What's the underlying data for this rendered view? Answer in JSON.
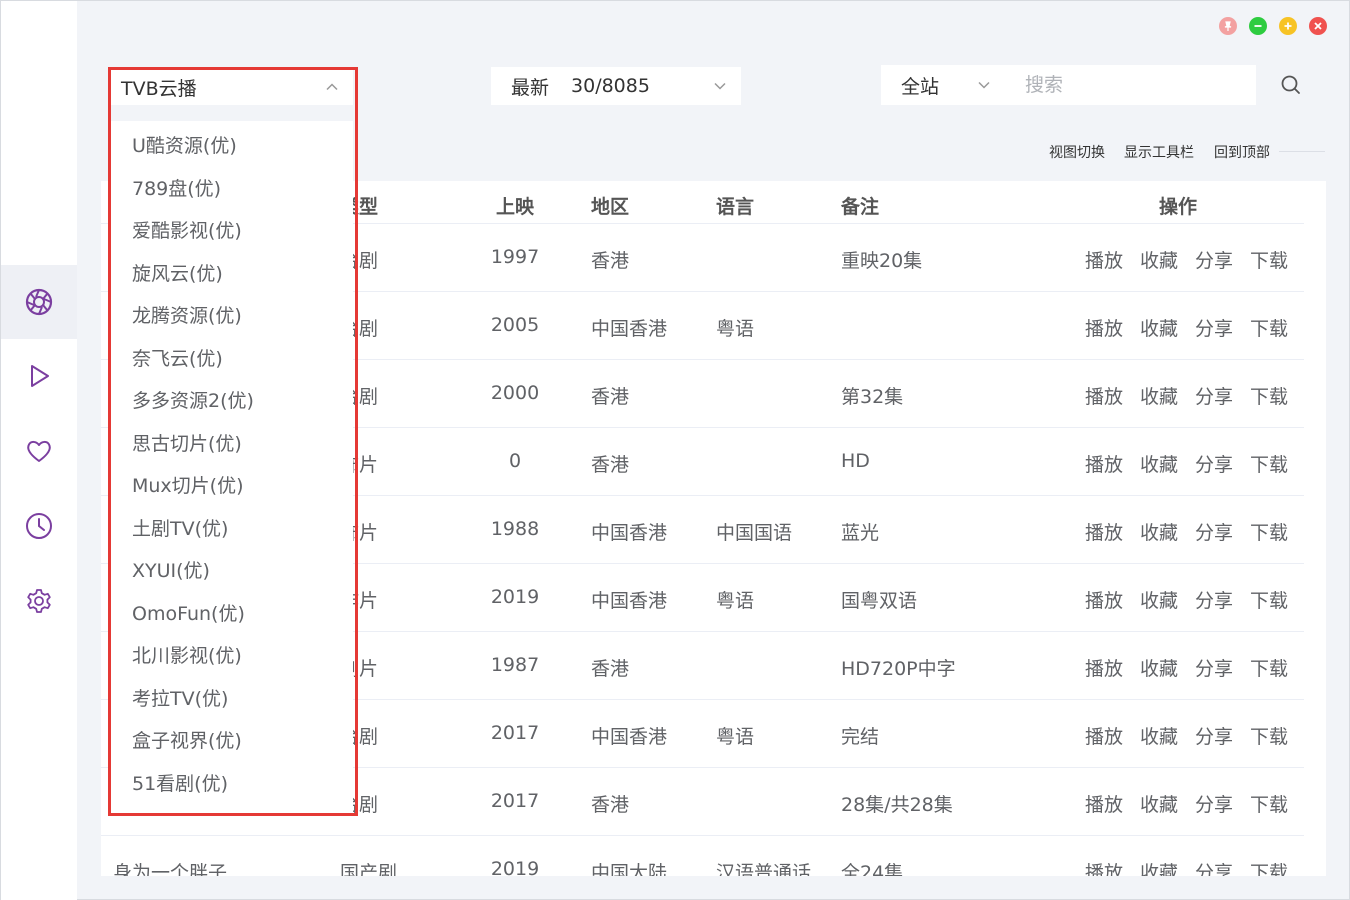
{
  "source": {
    "selected": "TVB云播"
  },
  "sort": {
    "label": "最新",
    "count": "30/8085"
  },
  "scope": {
    "label": "全站"
  },
  "search": {
    "placeholder": "搜索"
  },
  "toolbar": {
    "view_switch": "视图切换",
    "show_toolbar": "显示工具栏",
    "back_to_top": "回到顶部"
  },
  "table": {
    "headers": {
      "name": "",
      "type": "类型",
      "year": "上映",
      "region": "地区",
      "language": "语言",
      "note": "备注",
      "actions": "操作"
    },
    "actions": {
      "play": "播放",
      "favorite": "收藏",
      "share": "分享",
      "download": "下载"
    },
    "rows": [
      {
        "name": "",
        "type": "台剧",
        "year": "1997",
        "region": "香港",
        "language": "",
        "note": "重映20集"
      },
      {
        "name": "",
        "type": "台剧",
        "year": "2005",
        "region": "中国香港",
        "language": "粤语",
        "note": ""
      },
      {
        "name": "",
        "type": "台剧",
        "year": "2000",
        "region": "香港",
        "language": "",
        "note": "第32集"
      },
      {
        "name": "",
        "type": "怖片",
        "year": "0",
        "region": "香港",
        "language": "",
        "note": "HD"
      },
      {
        "name": "",
        "type": "怖片",
        "year": "1988",
        "region": "中国香港",
        "language": "中国国语",
        "note": "蓝光"
      },
      {
        "name": "",
        "type": "作片",
        "year": "2019",
        "region": "中国香港",
        "language": "粤语",
        "note": "国粤双语"
      },
      {
        "name": "",
        "type": "剧片",
        "year": "1987",
        "region": "香港",
        "language": "",
        "note": "HD720P中字"
      },
      {
        "name": "",
        "type": "台剧",
        "year": "2017",
        "region": "中国香港",
        "language": "粤语",
        "note": "完结"
      },
      {
        "name": "",
        "type": "台剧",
        "year": "2017",
        "region": "香港",
        "language": "",
        "note": "28集/共28集"
      },
      {
        "name": "身为一个胖子",
        "type": "国产剧",
        "year": "2019",
        "region": "中国大陆",
        "language": "汉语普通话",
        "note": "全24集"
      }
    ]
  },
  "dropdown": {
    "items": [
      "U酷资源(优)",
      "789盘(优)",
      "爱酷影视(优)",
      "旋风云(优)",
      "龙腾资源(优)",
      "奈飞云(优)",
      "多多资源2(优)",
      "思古切片(优)",
      "Mux切片(优)",
      "土剧TV(优)",
      "XYUI(优)",
      "OmoFun(优)",
      "北川影视(优)",
      "考拉TV(优)",
      "盒子视界(优)",
      "51看剧(优)"
    ]
  },
  "colors": {
    "accent": "#7b3fa0",
    "highlight": "#e53935",
    "pin": "#f3a1a1",
    "minimize": "#2ecc40",
    "maximize": "#f7c325",
    "close": "#f0524f"
  }
}
